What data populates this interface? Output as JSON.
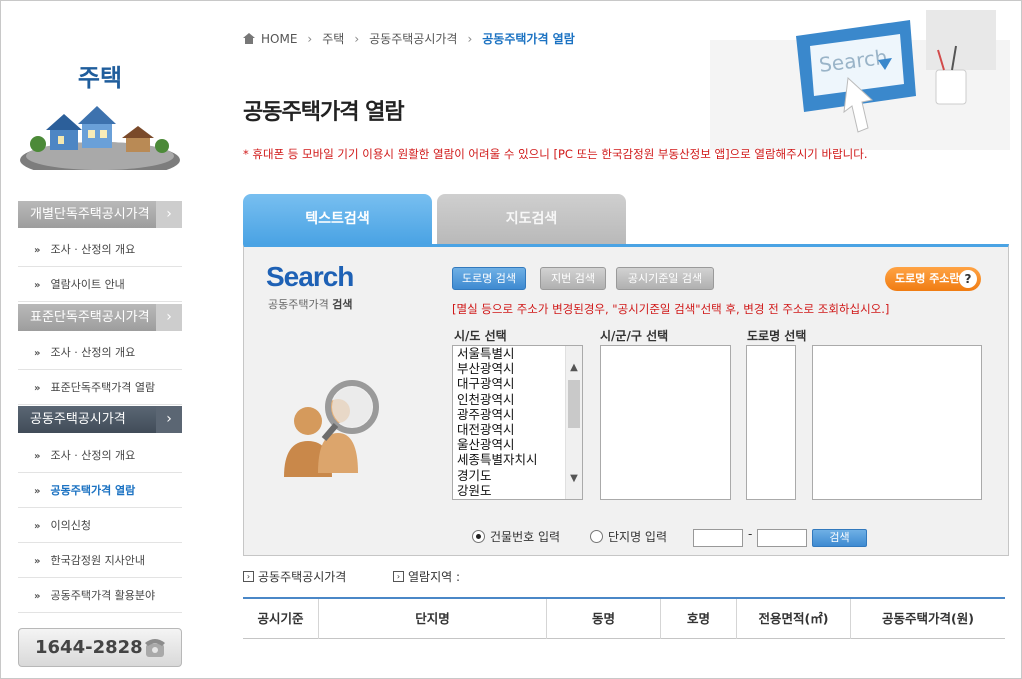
{
  "sidebar": {
    "title": "주택",
    "menus": [
      {
        "label": "개별단독주택공시가격"
      },
      {
        "label": "표준단독주택공시가격"
      },
      {
        "label": "공동주택공시가격"
      }
    ],
    "items": [
      {
        "label": "조사 · 산정의 개요"
      },
      {
        "label": "열람사이트 안내"
      },
      {
        "label": "조사 · 산정의 개요"
      },
      {
        "label": "표준단독주택가격 열람"
      },
      {
        "label": "조사 · 산정의 개요"
      },
      {
        "label": "공동주택가격 열람"
      },
      {
        "label": "이의신청"
      },
      {
        "label": "한국감정원 지사안내"
      },
      {
        "label": "공동주택가격 활용분야"
      }
    ],
    "phone": "1644-2828"
  },
  "breadcrumb": [
    "HOME",
    "주택",
    "공동주택공시가격",
    "공동주택가격 열람"
  ],
  "hero_search_text": "Search",
  "page_title": "공동주택가격 열람",
  "notice": "* 휴대폰 등 모바일 기기 이용시 원활한 열람이 어려울 수 있으니 [PC 또는 한국감정원 부동산정보 앱]으로 열람해주시기 바랍니다.",
  "tabs": {
    "text": "텍스트검색",
    "map": "지도검색"
  },
  "search": {
    "logo": "Search",
    "sub_prefix": "공동주택가격",
    "sub_bold": "검색",
    "buttons": {
      "road": "도로명 검색",
      "lot": "지번 검색",
      "date": "공시기준일 검색"
    },
    "road_address": "도로명 주소란",
    "warning": "[멸실 등으로 주소가 변경된경우, \"공시기준일 검색\"선택 후, 변경 전 주소로 조회하십시오.]",
    "labels": {
      "sido": "시/도 선택",
      "sigungu": "시/군/구 선택",
      "road": "도로명 선택"
    },
    "sido_options": [
      "서울특별시",
      "부산광역시",
      "대구광역시",
      "인천광역시",
      "광주광역시",
      "대전광역시",
      "울산광역시",
      "세종특별자치시",
      "경기도",
      "강원도"
    ],
    "radio_building": "건물번호 입력",
    "radio_complex": "단지명 입력",
    "dash": "-",
    "submit": "검색"
  },
  "result": {
    "label1": "공동주택공시가격",
    "label2": "열람지역 :",
    "headers": [
      "공시기준",
      "단지명",
      "동명",
      "호명",
      "전용면적(㎡)",
      "공동주택가격(원)"
    ]
  }
}
